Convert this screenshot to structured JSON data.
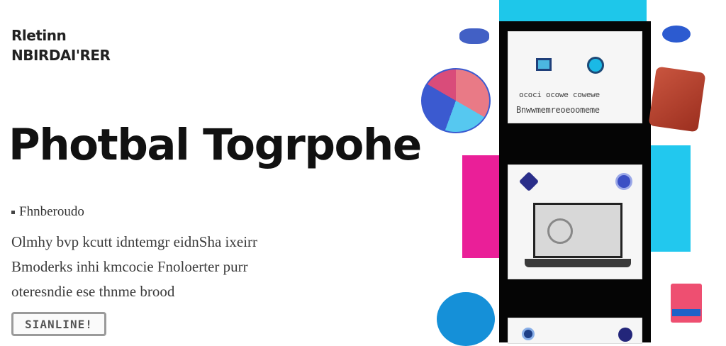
{
  "brand": {
    "line1": "Rletinn",
    "line2": "NBIRDAI'RER"
  },
  "hero": {
    "headline": "Photbal Togrpohe",
    "subheading": "Fhnberoudo",
    "body_lines": [
      "Olmhy bvp kcutt idntemgr eidnSha ixeirr",
      "Bmoderks inhi kmcocie Fnoloerter purr",
      "oteresndie ese thnme brood"
    ],
    "cta_label": "SIANLINE!"
  },
  "illustration": {
    "card1_lines": [
      "ococi ocowe cowewe",
      "Bnwwmemreoeoomeme"
    ]
  },
  "colors": {
    "accent_cyan": "#1ec7ea",
    "accent_magenta": "#ea1f98",
    "accent_blue": "#1590d8",
    "tower": "#050505"
  }
}
